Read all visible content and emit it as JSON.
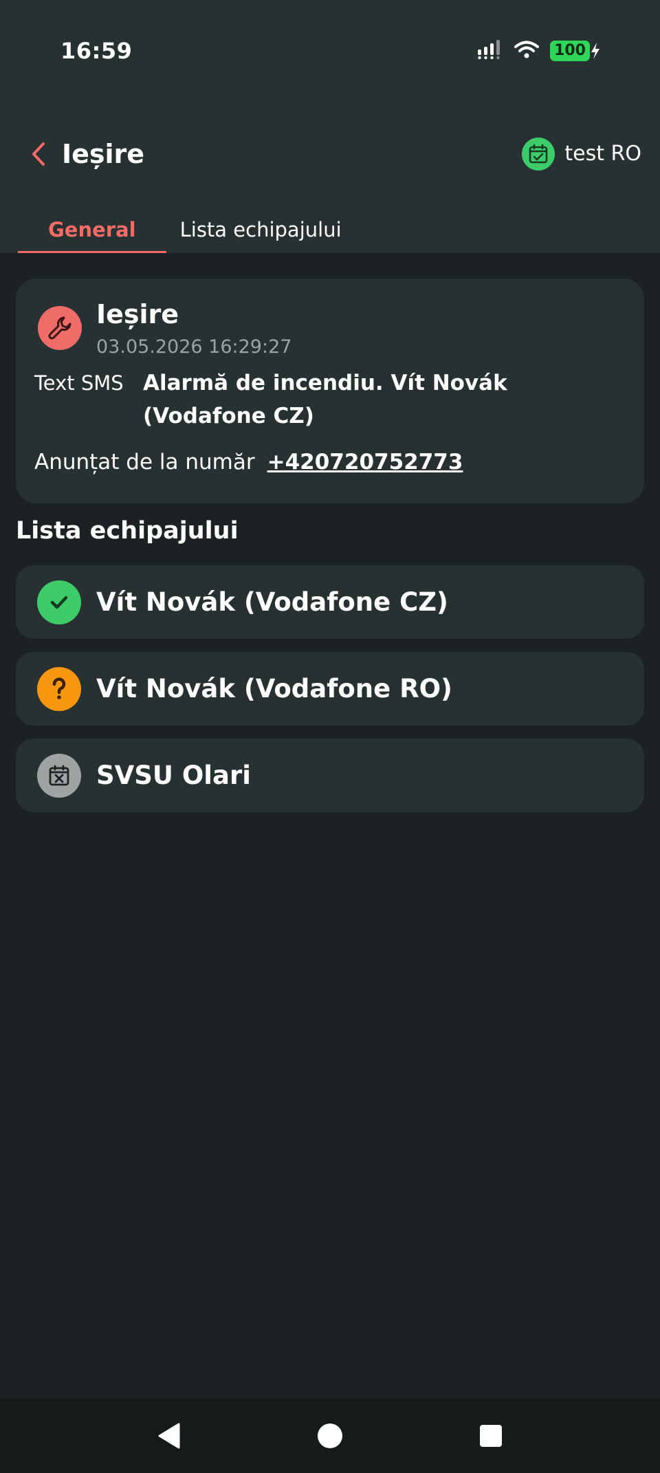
{
  "status_bar": {
    "time": "16:59",
    "battery": "100"
  },
  "header": {
    "title": "Ieșire",
    "right_label": "test RO"
  },
  "tabs": [
    {
      "label": "General",
      "active": true
    },
    {
      "label": "Lista echipajului",
      "active": false
    }
  ],
  "event": {
    "title": "Ieșire",
    "datetime": "03.05.2026 16:29:27",
    "sms_label": "Text SMS",
    "sms_text": "Alarmă de incendiu. Vít Novák (Vodafone CZ)",
    "phone_label": "Anunțat de la număr",
    "phone_number": "+420720752773",
    "icon": "wrench-icon"
  },
  "crew": {
    "title": "Lista echipajului",
    "members": [
      {
        "name": "Vít Novák (Vodafone CZ)",
        "status": "confirmed",
        "icon": "check-icon",
        "color": "#3ecb6a"
      },
      {
        "name": "Vít Novák (Vodafone RO)",
        "status": "unknown",
        "icon": "question-icon",
        "color": "#f7970f"
      },
      {
        "name": "SVSU Olari",
        "status": "unavailable",
        "icon": "calendar-x-icon",
        "color": "#9ea3a4"
      }
    ]
  },
  "colors": {
    "accent": "#f26b66",
    "header_bg": "#283132",
    "page_bg": "#1c2223",
    "card_bg": "#283132"
  }
}
